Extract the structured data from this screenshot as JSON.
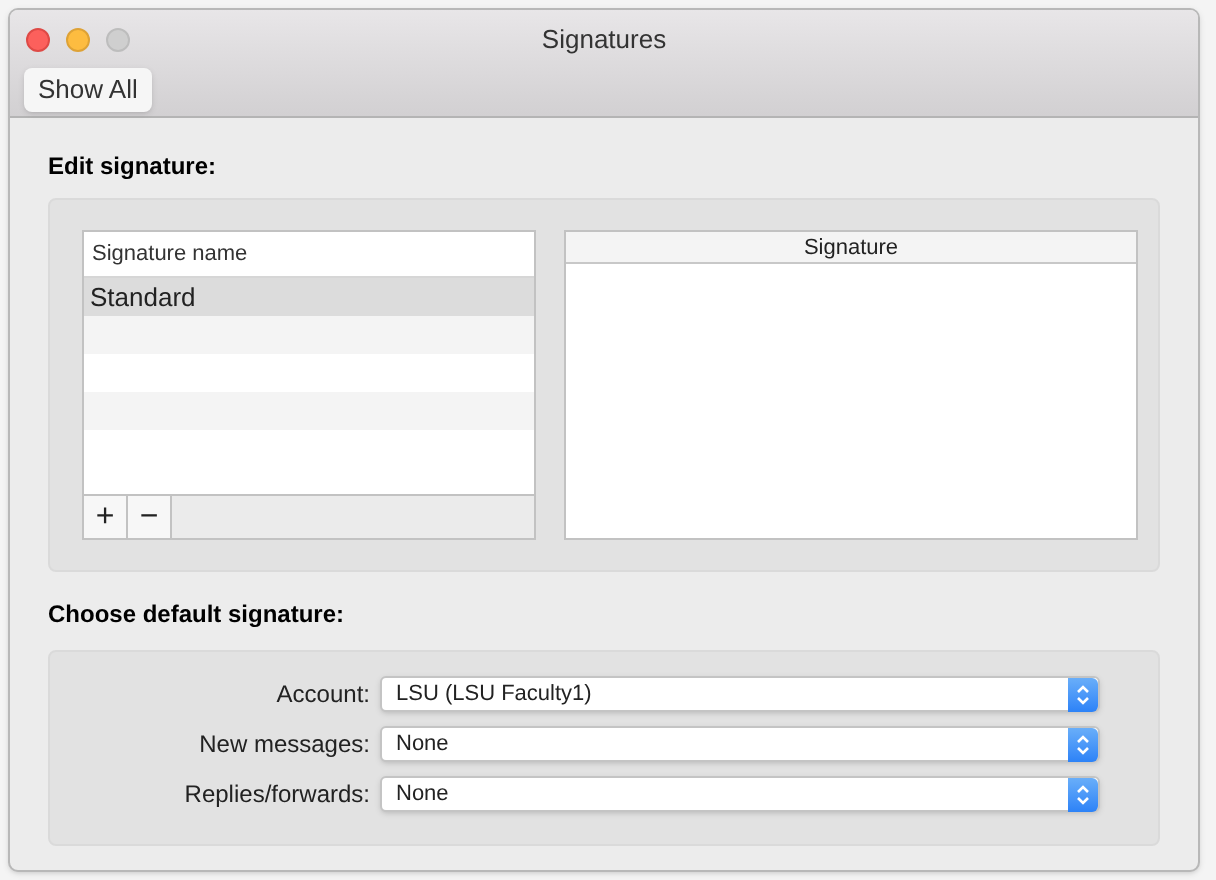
{
  "window": {
    "title": "Signatures"
  },
  "toolbar": {
    "show_all_button": "Show All"
  },
  "edit_section": {
    "heading": "Edit signature:",
    "list": {
      "column": "Signature name",
      "rows": [
        {
          "name": "Standard",
          "selected": true
        }
      ],
      "add_button": "+",
      "remove_button": "−"
    },
    "signature_pane": {
      "column": "Signature"
    }
  },
  "default_section": {
    "heading": "Choose default signature:",
    "fields": [
      {
        "label": "Account:",
        "value": "LSU (LSU Faculty1)"
      },
      {
        "label": "New messages:",
        "value": "None"
      },
      {
        "label": "Replies/forwards:",
        "value": "None"
      }
    ]
  }
}
